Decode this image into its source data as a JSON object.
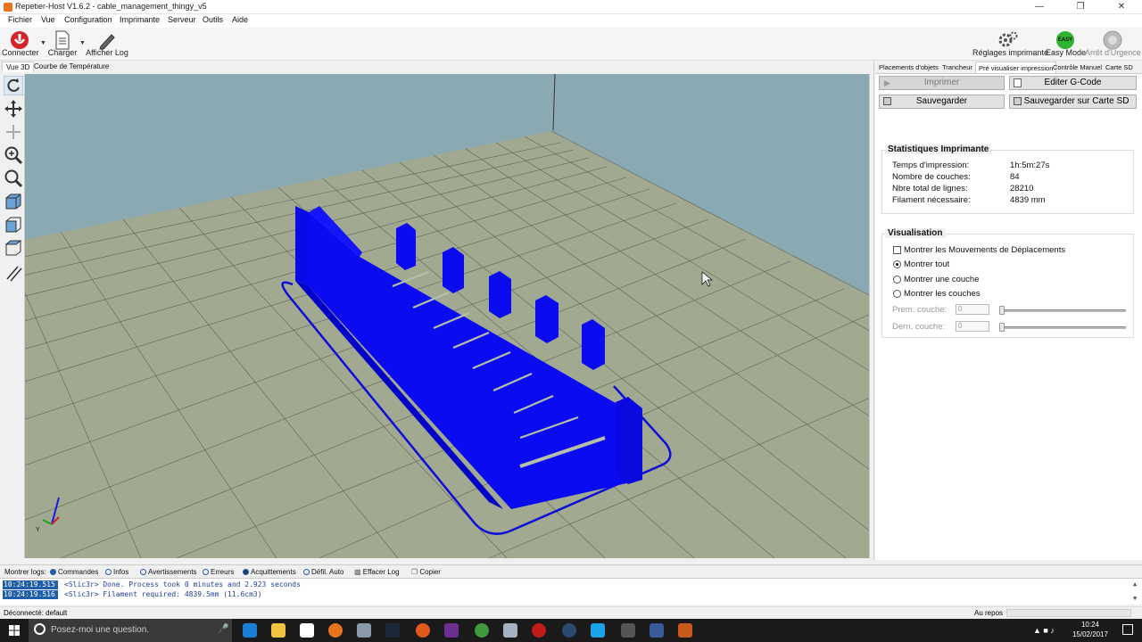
{
  "window": {
    "title": "Repetier-Host V1.6.2 - cable_management_thingy_v5"
  },
  "menu": [
    "Fichier",
    "Vue",
    "Configuration",
    "Imprimante",
    "Serveur",
    "Outils",
    "Aide"
  ],
  "toolbar": {
    "connect": "Connecter",
    "load": "Charger",
    "show_log": "Afficher Log",
    "printer_settings": "Réglages imprimante",
    "easy_mode": "Easy Mode",
    "easy_badge": "EASY",
    "emergency": "Arrêt d'Urgence"
  },
  "left_tabs": [
    "Vue 3D",
    "Courbe de Température"
  ],
  "right_tabs": [
    "Placements d'objets",
    "Trancheur",
    "Pré visualiser impression",
    "Contrôle Manuel",
    "Carte SD"
  ],
  "preview": {
    "print_button": "Imprimer",
    "edit_gcode_button": "Editer G-Code",
    "save_button": "Sauvegarder",
    "save_sd_button": "Sauvegarder sur Carte SD",
    "stats_title": "Statistiques Imprimante",
    "stats": [
      {
        "label": "Temps d'impression:",
        "value": "1h:5m:27s"
      },
      {
        "label": "Nombre de couches:",
        "value": "84"
      },
      {
        "label": "Nbre total de lignes:",
        "value": "28210"
      },
      {
        "label": "Filament nécessaire:",
        "value": "4839 mm"
      }
    ],
    "vis_title": "Visualisation",
    "show_travel": "Montrer les Mouvements de Déplacements",
    "show_all": "Montrer tout",
    "show_one_layer": "Montrer une couche",
    "show_layers": "Montrer les couches",
    "first_layer_label": "Prem. couche:",
    "last_layer_label": "Dern. couche:",
    "first_layer_value": "0",
    "last_layer_value": "0",
    "selected_mode": "show_all"
  },
  "log": {
    "label": "Montrer logs:",
    "options": [
      "Commandes",
      "Infos",
      "Avertissements",
      "Erreurs",
      "Acquittements",
      "Défil. Auto",
      "Effacer Log",
      "Copier"
    ],
    "lines": [
      {
        "time": "10:24:19.515",
        "msg": "<Slic3r> Done. Process took 0 minutes and 2.923 seconds"
      },
      {
        "time": "10:24:19.516",
        "msg": "<Slic3r> Filament required: 4839.5mm (11.6cm3)"
      }
    ]
  },
  "status": {
    "left": "Déconnecté: default",
    "right": "Au repos"
  },
  "taskbar": {
    "search_placeholder": "Posez-moi une question.",
    "time": "10:24",
    "date": "15/02/2017"
  },
  "colors": {
    "model": "#0b0bf0",
    "background": "#8aa9b2",
    "accent": "#1f5ea8"
  }
}
